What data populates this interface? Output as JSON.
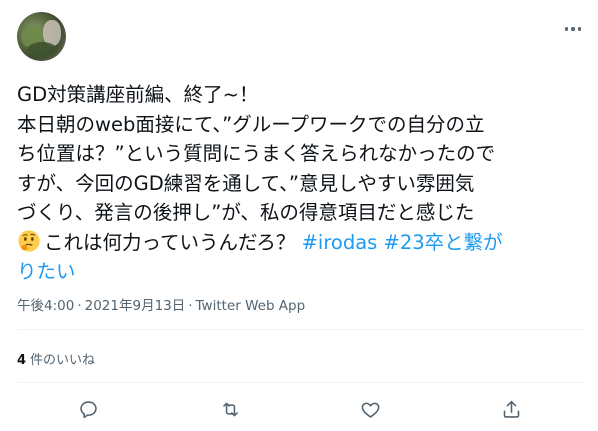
{
  "tweet": {
    "lines": [
      "GD対策講座前編、終了~！",
      "本日朝のweb面接にて、”グループワークでの自分の立",
      "ち位置は？”という質問にうまく答えられなかったので",
      "すが、今回のGD練習を通して、”意見しやすい雰囲気",
      "づくり、発言の後押し”が、私の得意項目だと感じた"
    ],
    "line6_text": "これは何力っていうんだろ？",
    "hashtag1": "#irodas",
    "hashtag2_part1": "#23卒と繋が",
    "hashtag2_part2": "りたい",
    "emoji": "thinking-face"
  },
  "meta": {
    "time": "午後4:00",
    "separator": "·",
    "date": "2021年9月13日",
    "source": "Twitter Web App"
  },
  "likes": {
    "count": "4",
    "label": "件のいいね"
  },
  "colors": {
    "text": "#0f1419",
    "secondary": "#536471",
    "link": "#1d9bf0",
    "divider": "#eff3f4"
  },
  "icons": {
    "more": "more-horizontal-icon",
    "reply": "reply-icon",
    "retweet": "retweet-icon",
    "like": "heart-icon",
    "share": "share-icon"
  }
}
